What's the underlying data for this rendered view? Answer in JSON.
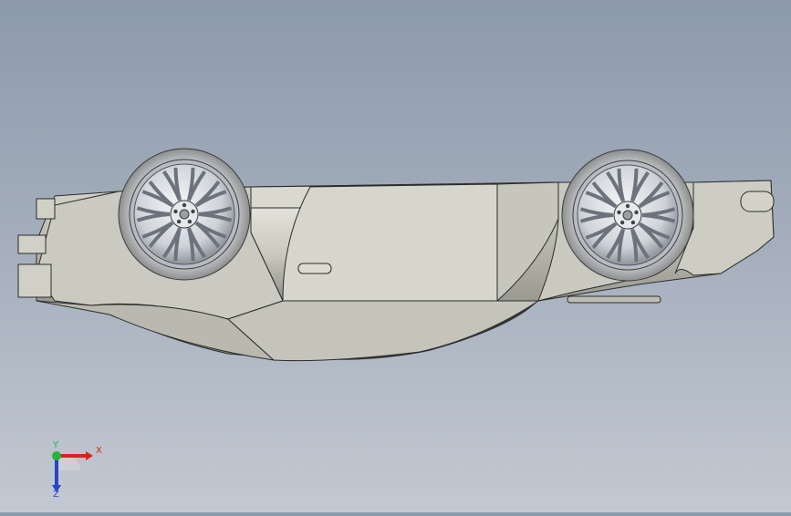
{
  "viewport": {
    "background_top": "#8d9aac",
    "background_bottom": "#c3c9d2",
    "model_fill": "#cfcfc6",
    "model_shadow": "#8a8a80",
    "model_edge": "#2c2c2c",
    "rim_color": "#e4e6ea",
    "tire_color": "#b9bbbd"
  },
  "triad": {
    "x_label": "X",
    "y_label": "Y",
    "z_label": "Z",
    "x_color": "#e0201c",
    "y_color": "#27b43a",
    "z_color": "#2a43c8"
  }
}
